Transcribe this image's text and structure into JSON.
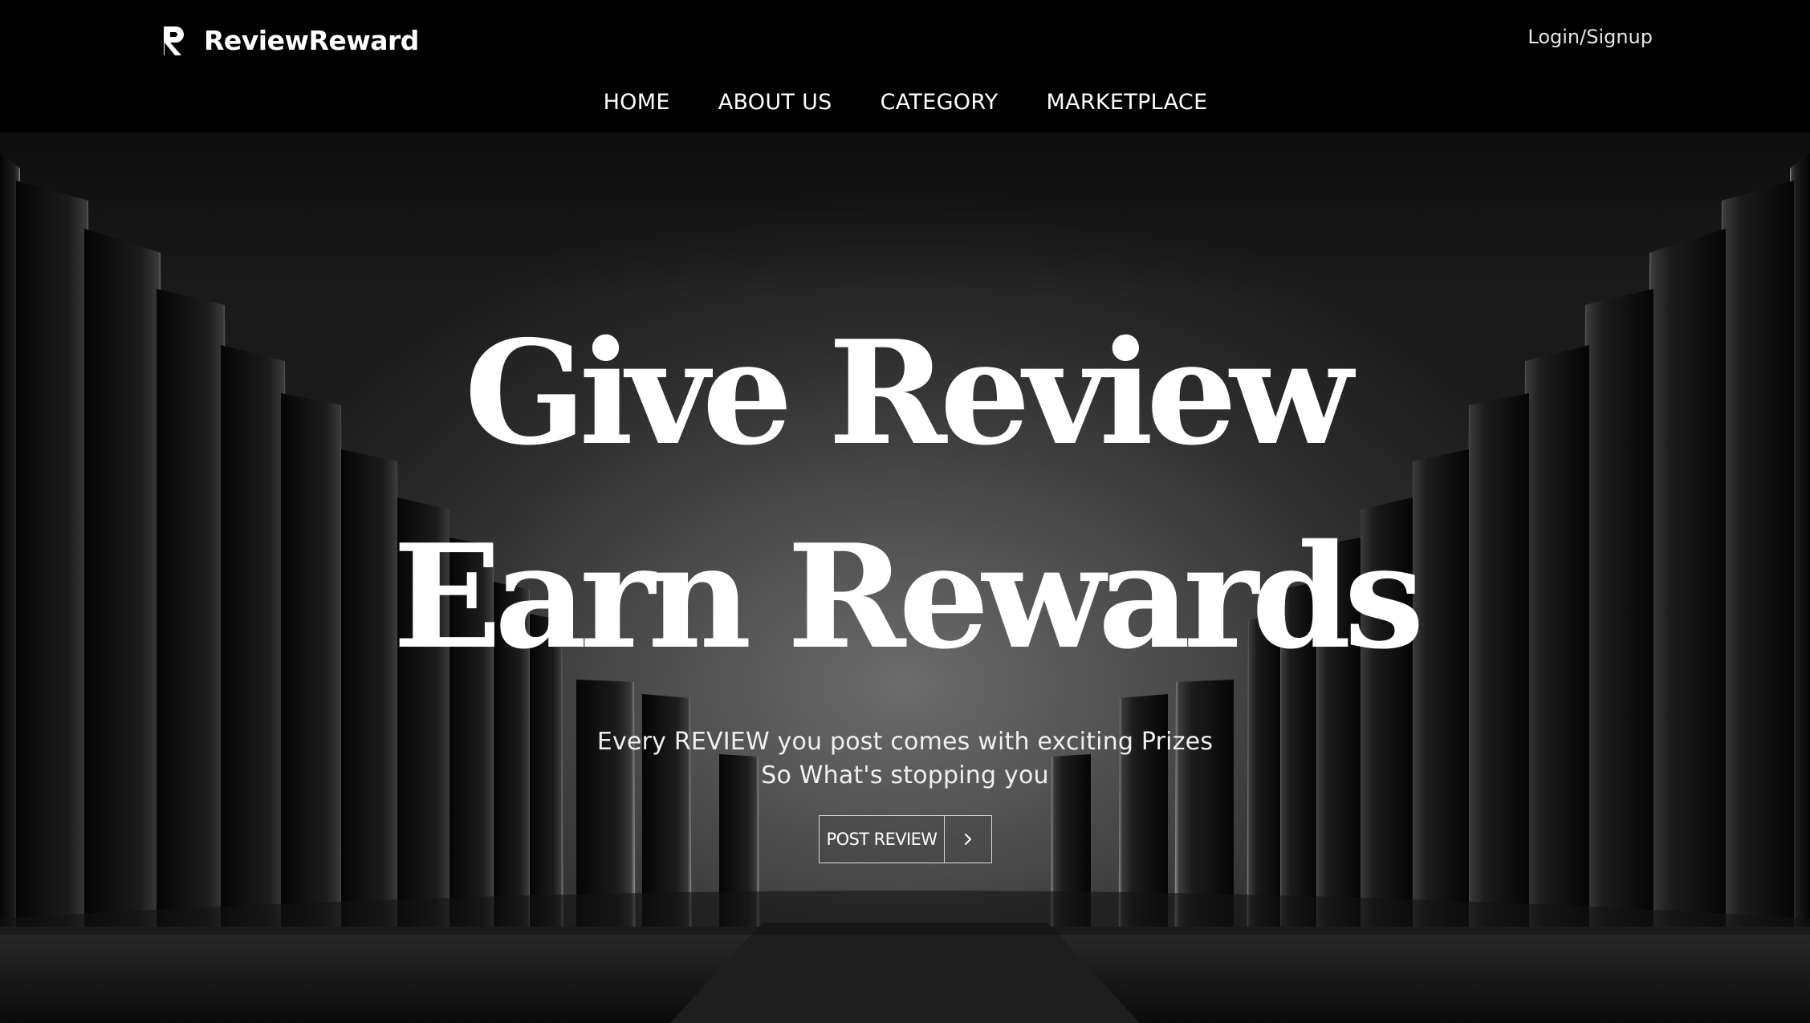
{
  "header": {
    "brand": "ReviewReward",
    "login_label": "Login/Signup",
    "nav": [
      {
        "label": "HOME"
      },
      {
        "label": "ABOUT US"
      },
      {
        "label": "CATEGORY"
      },
      {
        "label": "MARKETPLACE"
      }
    ]
  },
  "hero": {
    "headline_line1": "Give Review",
    "headline_line2": "Earn Rewards",
    "subtext_line1": "Every REVIEW you post comes with exciting Prizes",
    "subtext_line2": "So What's stopping you",
    "cta_label": "POST REVIEW",
    "cta_icon": "chevron-right-icon"
  },
  "colors": {
    "header_bg": "#000000",
    "text": "#ffffff",
    "hero_glow": "#6c6c6c"
  }
}
